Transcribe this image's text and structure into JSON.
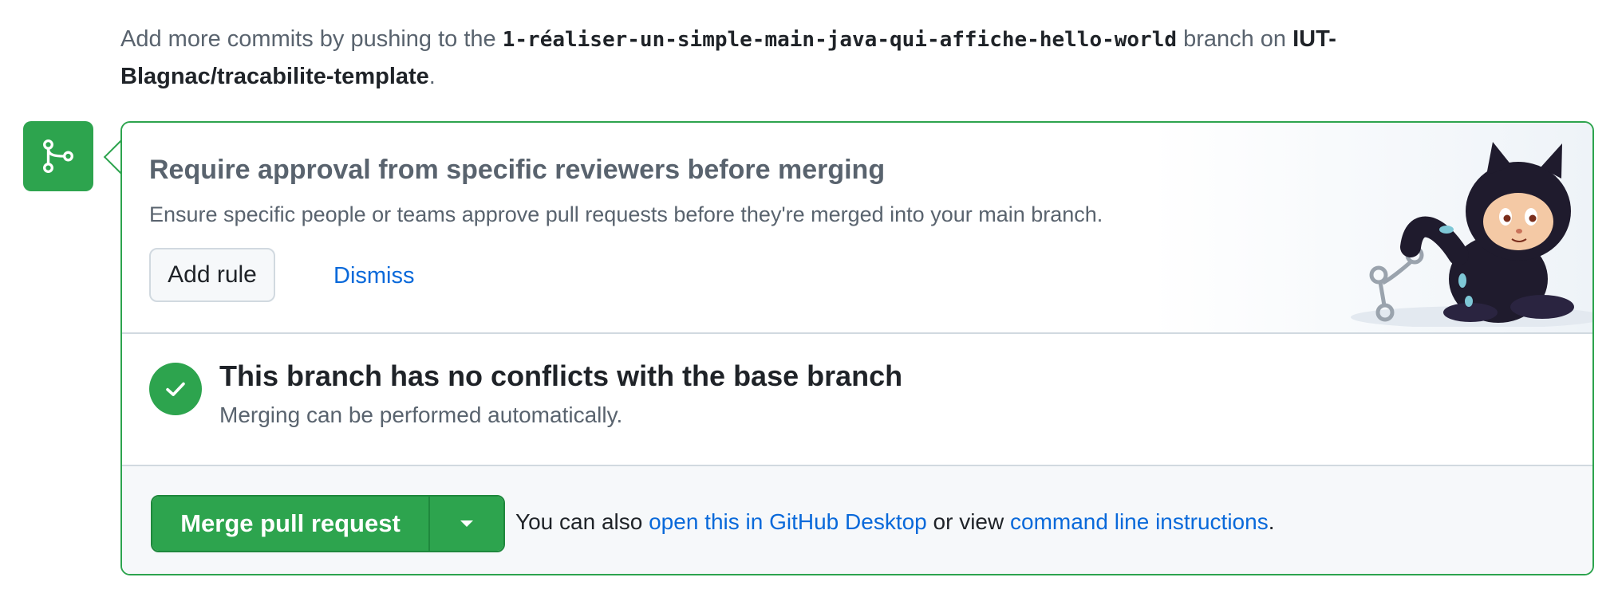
{
  "intro": {
    "prefix": "Add more commits by pushing to the ",
    "branch": "1-réaliser-un-simple-main-java-qui-affiche-hello-world",
    "middle": " branch on ",
    "repo": "IUT-Blagnac/tracabilite-template",
    "suffix": "."
  },
  "promo": {
    "title": "Require approval from specific reviewers before merging",
    "description": "Ensure specific people or teams approve pull requests before they're merged into your main branch.",
    "add_rule_label": "Add rule",
    "dismiss_label": "Dismiss"
  },
  "status": {
    "title": "This branch has no conflicts with the base branch",
    "subtitle": "Merging can be performed automatically."
  },
  "actions": {
    "merge_label": "Merge pull request",
    "also_prefix": "You can also ",
    "desktop_link": "open this in GitHub Desktop",
    "or_view": " or view ",
    "cli_link": "command line instructions",
    "suffix": "."
  },
  "colors": {
    "success": "#2da44e",
    "link": "#0969da",
    "muted": "#59636e"
  },
  "icons": {
    "merge": "git-merge-icon",
    "check": "check-icon",
    "caret": "triangle-down-icon",
    "mascot": "octocat-illustration"
  }
}
